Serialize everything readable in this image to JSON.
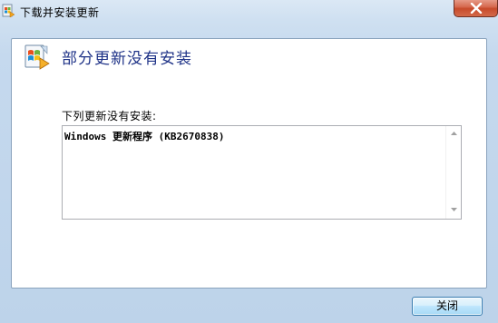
{
  "window": {
    "title": "下载并安装更新",
    "title_icon": "windows-update-icon",
    "close_icon": "close-icon"
  },
  "main": {
    "icon": "windows-update-icon",
    "heading": "部分更新没有安装",
    "list_label": "下列更新没有安装:",
    "items": [
      "Windows 更新程序 (KB2670838)"
    ],
    "scroll_up_icon": "scroll-up-arrow-icon",
    "scroll_down_icon": "scroll-down-arrow-icon"
  },
  "footer": {
    "close_label": "关闭"
  },
  "colors": {
    "heading": "#1e3287",
    "close_button_red": "#c74a2b",
    "button_border": "#3c7fb1"
  }
}
